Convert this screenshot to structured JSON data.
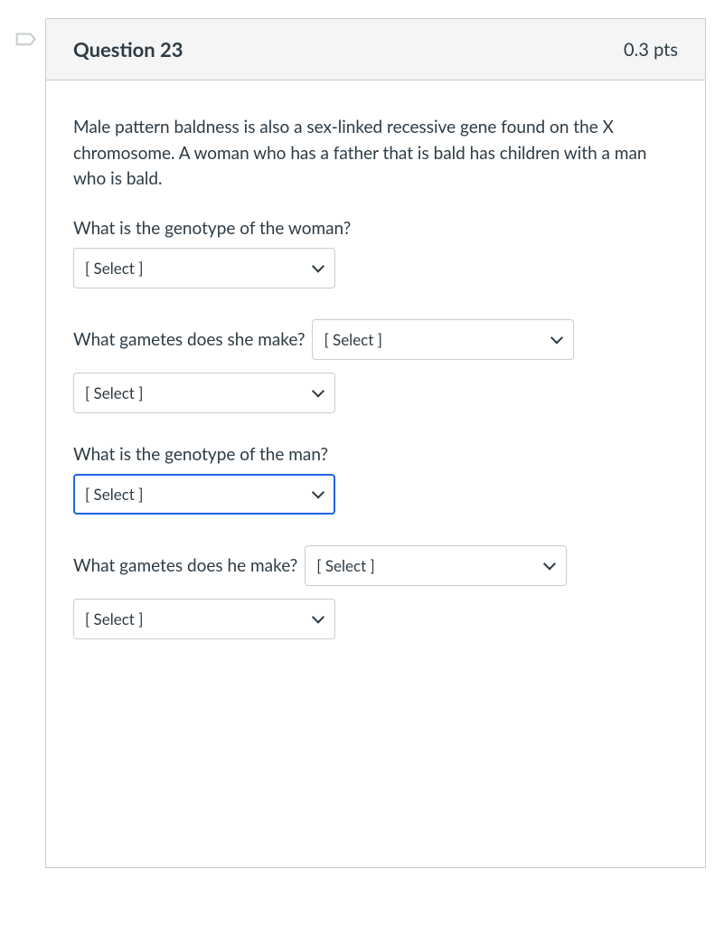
{
  "header": {
    "title": "Question 23",
    "points": "0.3 pts"
  },
  "prompt": "Male pattern baldness is also a sex-linked recessive gene found on the X chromosome. A woman who has a father that is bald has children with a man who is bald.",
  "questions": {
    "q1": {
      "label": "What is the genotype of the woman?",
      "select1": "[ Select ]"
    },
    "q2": {
      "label": "What gametes does she make?",
      "select1": "[ Select ]",
      "select2": "[ Select ]"
    },
    "q3": {
      "label": "What is the genotype of the man?",
      "select1": "[ Select ]"
    },
    "q4": {
      "label": "What gametes does he make?",
      "select1": "[ Select ]",
      "select2": "[ Select ]"
    }
  }
}
